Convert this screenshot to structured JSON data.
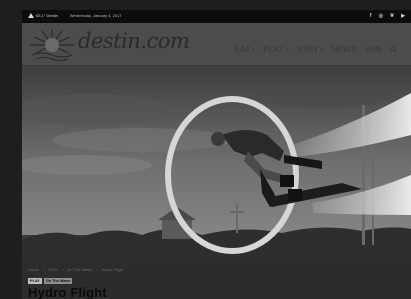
{
  "topbar": {
    "weather": "63.1° Destin",
    "date": "Wednesday, January 4, 2017",
    "social": [
      "f",
      "◎",
      "❦",
      "▶"
    ]
  },
  "header": {
    "logo": "destin.com",
    "nav": [
      {
        "label": "EAT",
        "caret": "˅"
      },
      {
        "label": "PLAY",
        "caret": "˅"
      },
      {
        "label": "STAY",
        "caret": "˅"
      },
      {
        "label": "NEWS",
        "caret": ""
      },
      {
        "label": "WIN",
        "caret": ""
      }
    ]
  },
  "breadcrumb": [
    "Home",
    "›",
    "PLAY",
    "›",
    "On The Water",
    "›",
    "Hydro Flight"
  ],
  "tags": [
    "PLAY",
    "On The Water"
  ],
  "article": {
    "title": "Hydro Flight"
  }
}
